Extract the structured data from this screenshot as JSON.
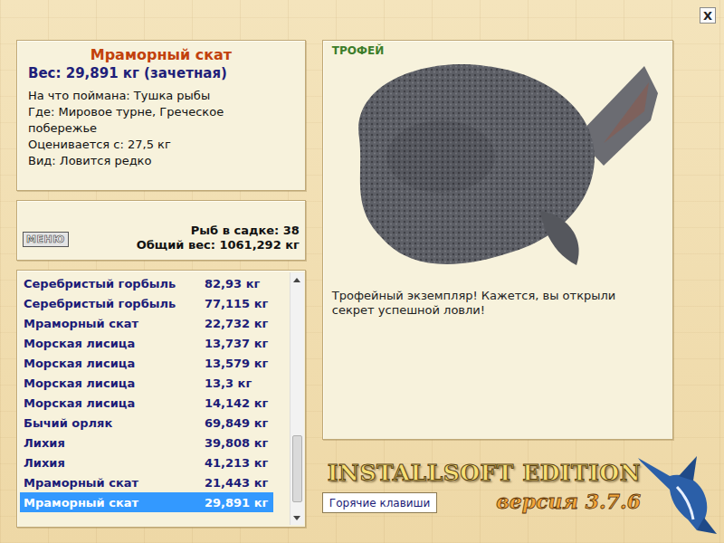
{
  "window": {
    "close": "X"
  },
  "fish_card": {
    "title": "Мраморный скат",
    "weight": "Вес: 29,891 кг (зачетная)",
    "details": [
      "На что поймана: Тушка рыбы",
      "Где: Мировое турне, Греческое побережье",
      "Оценивается с: 27,5 кг",
      "Вид: Ловится редко"
    ]
  },
  "cage": {
    "menu_button": "МЕНЮ",
    "count": "Рыб в садке: 38",
    "total": "Общий вес: 1061,292 кг"
  },
  "catch_list": {
    "scroll_position": 0.95,
    "rows": [
      {
        "name": "Серебристый горбыль",
        "weight": "82,93 кг",
        "selected": false
      },
      {
        "name": "Серебристый горбыль",
        "weight": "77,115 кг",
        "selected": false
      },
      {
        "name": "Мраморный скат",
        "weight": "22,732 кг",
        "selected": false
      },
      {
        "name": "Морская лисица",
        "weight": "13,737 кг",
        "selected": false
      },
      {
        "name": "Морская лисица",
        "weight": "13,579 кг",
        "selected": false
      },
      {
        "name": "Морская лисица",
        "weight": "13,3 кг",
        "selected": false
      },
      {
        "name": "Морская лисица",
        "weight": "14,142 кг",
        "selected": false
      },
      {
        "name": "Бычий орляк",
        "weight": "69,849 кг",
        "selected": false
      },
      {
        "name": "Лихия",
        "weight": "39,808 кг",
        "selected": false
      },
      {
        "name": "Лихия",
        "weight": "41,213 кг",
        "selected": false
      },
      {
        "name": "Мраморный скат",
        "weight": "21,443 кг",
        "selected": false
      },
      {
        "name": "Мраморный скат",
        "weight": "29,891 кг",
        "selected": true
      }
    ]
  },
  "trophy": {
    "badge": "ТРОФЕЙ",
    "message": "Трофейный экземпляр! Кажется, вы открыли секрет успешной ловли!"
  },
  "branding": {
    "logo": "INSTALLSOFT EDITION",
    "version": "версия 3.7.6"
  },
  "buttons": [
    "Горячие клавиши"
  ]
}
